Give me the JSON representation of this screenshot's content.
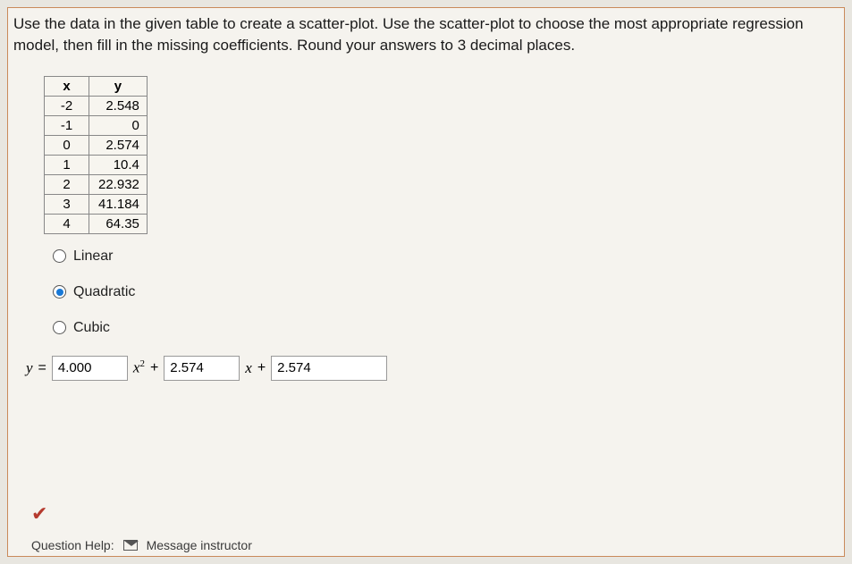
{
  "prompt": "Use the data in the given table to create a scatter-plot. Use the scatter-plot to choose the most appropriate regression model, then fill in the missing coefficients. Round your answers to 3 decimal places.",
  "table": {
    "headers": {
      "x": "x",
      "y": "y"
    },
    "rows": [
      {
        "x": "-2",
        "y": "2.548"
      },
      {
        "x": "-1",
        "y": "0"
      },
      {
        "x": "0",
        "y": "2.574"
      },
      {
        "x": "1",
        "y": "10.4"
      },
      {
        "x": "2",
        "y": "22.932"
      },
      {
        "x": "3",
        "y": "41.184"
      },
      {
        "x": "4",
        "y": "64.35"
      }
    ]
  },
  "options": {
    "linear": "Linear",
    "quadratic": "Quadratic",
    "cubic": "Cubic",
    "selected": "quadratic"
  },
  "equation": {
    "lhs": "y",
    "eq": "=",
    "coef_a": "4.000",
    "term1_var": "x",
    "term1_exp": "2",
    "plus1": "+",
    "coef_b": "2.574",
    "term2_var": "x",
    "plus2": "+",
    "coef_c": "2.574"
  },
  "footer": {
    "help_label": "Question Help:",
    "msg_label": "Message instructor"
  },
  "chart_data": {
    "type": "table",
    "title": "Scatter-plot data for regression",
    "x": [
      -2,
      -1,
      0,
      1,
      2,
      3,
      4
    ],
    "y": [
      2.548,
      0,
      2.574,
      10.4,
      22.932,
      41.184,
      64.35
    ],
    "xlabel": "x",
    "ylabel": "y"
  }
}
